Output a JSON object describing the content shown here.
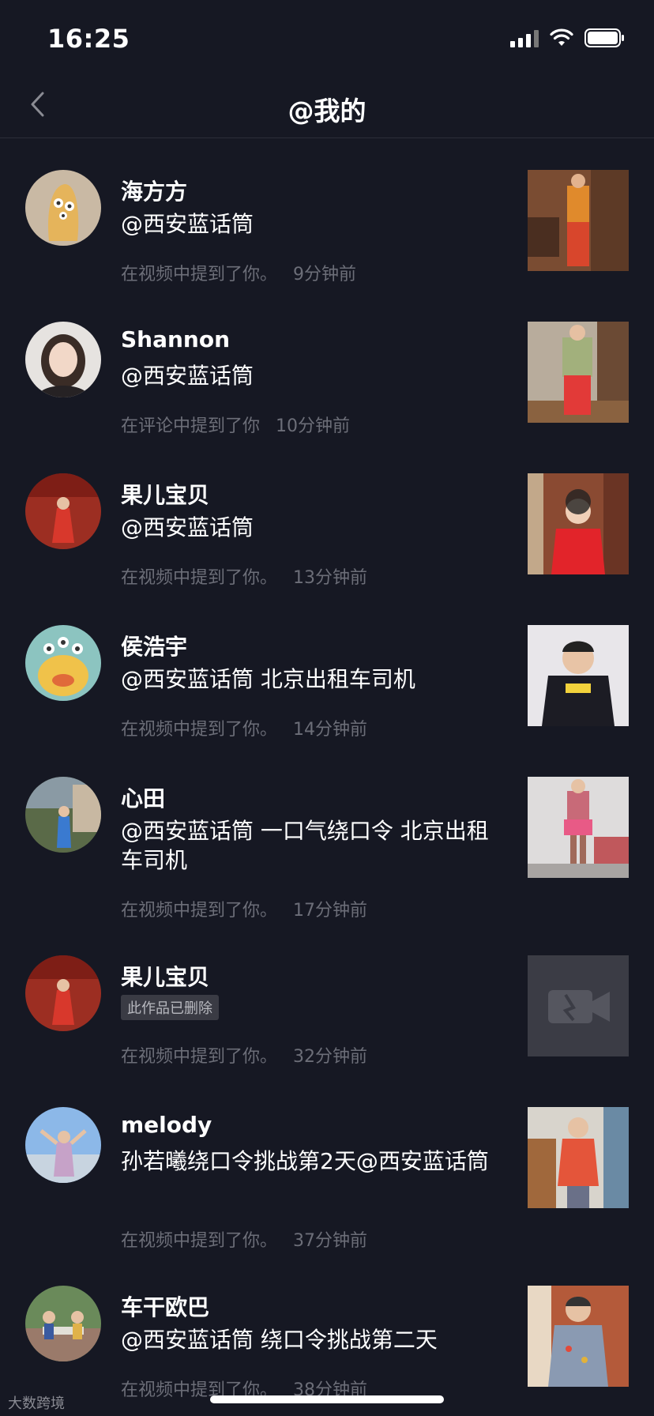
{
  "status": {
    "time": "16:25"
  },
  "nav": {
    "title": "@我的"
  },
  "items": [
    {
      "name": "海方方",
      "content": "@西安蓝话筒",
      "meta": "在视频中提到了你。",
      "time": "9分钟前"
    },
    {
      "name": "Shannon",
      "content": "@西安蓝话筒",
      "meta": "在评论中提到了你",
      "time": "10分钟前"
    },
    {
      "name": "果儿宝贝",
      "content": "@西安蓝话筒",
      "meta": "在视频中提到了你。",
      "time": "13分钟前"
    },
    {
      "name": "侯浩宇",
      "content": "@西安蓝话筒 北京出租车司机",
      "meta": "在视频中提到了你。",
      "time": "14分钟前"
    },
    {
      "name": "心田",
      "content": "@西安蓝话筒 一口气绕口令 北京出租车司机",
      "meta": "在视频中提到了你。",
      "time": "17分钟前"
    },
    {
      "name": "果儿宝贝",
      "badge": "此作品已删除",
      "meta": "在视频中提到了你。",
      "time": "32分钟前"
    },
    {
      "name": "melody",
      "content": "孙若曦绕口令挑战第2天@西安蓝话筒",
      "meta": "在视频中提到了你。",
      "time": "37分钟前"
    },
    {
      "name": "车干欧巴",
      "content": "@西安蓝话筒 绕口令挑战第二天",
      "meta": "在视频中提到了你。",
      "time": "38分钟前"
    }
  ],
  "watermark": "大数跨境",
  "colors": {
    "background": "#161823",
    "secondary_text": "#6c6e78",
    "divider": "#2c2e38"
  }
}
